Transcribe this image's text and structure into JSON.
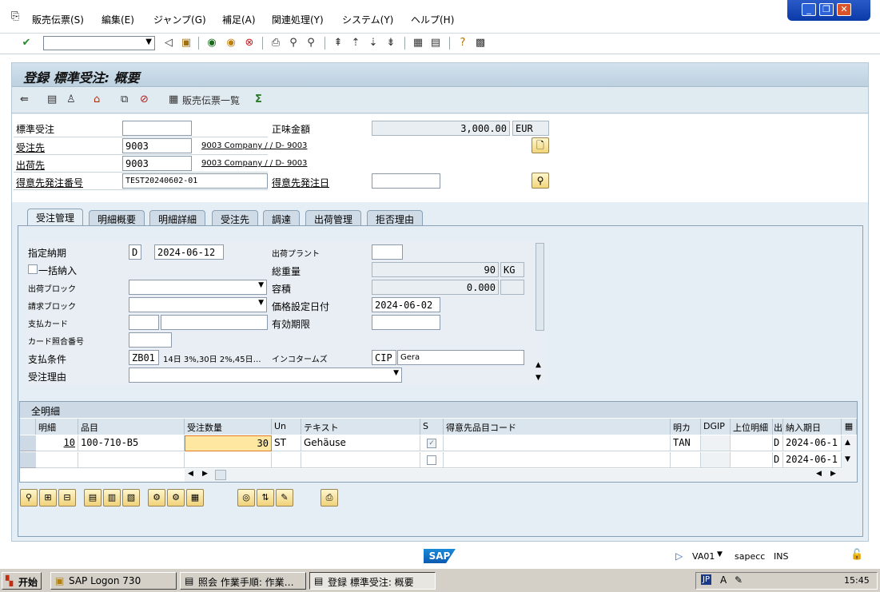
{
  "menu": [
    "販売伝票(S)",
    "編集(E)",
    "ジャンプ(G)",
    "補足(A)",
    "関連処理(Y)",
    "システム(Y)",
    "ヘルプ(H)"
  ],
  "window_title": "登録 標準受注: 概要",
  "app_toolbar": {
    "doc_list_label": "販売伝票一覧"
  },
  "header": {
    "std_order_label": "標準受注",
    "net_value_label": "正味金額",
    "net_value": "3,000.00",
    "currency": "EUR",
    "sold_to_label": "受注先",
    "sold_to": "9003",
    "sold_to_desc": "9003 Company / / D- 9003",
    "ship_to_label": "出荷先",
    "ship_to": "9003",
    "ship_to_desc": "9003 Company / / D- 9003",
    "po_number_label": "得意先発注番号",
    "po_number": "TEST20240602-01",
    "po_date_label": "得意先発注日"
  },
  "tabs": [
    "受注管理",
    "明細概要",
    "明細詳細",
    "受注先",
    "調達",
    "出荷管理",
    "拒否理由"
  ],
  "sales_tab": {
    "req_deliv_label": "指定納期",
    "req_deliv_type": "D",
    "req_deliv_date": "2024-06-12",
    "delivering_plant_label": "出荷プラント",
    "complete_dlv_label": "一括納入",
    "total_weight_label": "総重量",
    "total_weight": "90",
    "weight_unit": "KG",
    "delivery_block_label": "出荷ブロック",
    "volume_label": "容積",
    "volume": "0.000",
    "billing_block_label": "請求ブロック",
    "pricing_date_label": "価格設定日付",
    "pricing_date": "2024-06-02",
    "payment_card_label": "支払カード",
    "valid_to_label": "有効期限",
    "card_verif_label": "カード照合番号",
    "payment_terms_label": "支払条件",
    "payment_terms": "ZB01",
    "payment_terms_desc": "14日 3%,30日 2%,45日…",
    "incoterms_label": "インコタームズ",
    "incoterms": "CIP",
    "incoterms_place": "Gera",
    "order_reason_label": "受注理由"
  },
  "items_table": {
    "title": "全明細",
    "headers": [
      "明細",
      "品目",
      "受注数量",
      "Un",
      "テキスト",
      "S",
      "得意先品目コード",
      "明カ",
      "DGIP",
      "上位明細",
      "出",
      "納入期日"
    ],
    "rows": [
      {
        "item": "10",
        "material": "100-710-B5",
        "qty": "30",
        "unit": "ST",
        "text": "Gehäuse",
        "cat": "TAN",
        "dlv": "D",
        "date": "2024-06-1"
      },
      {
        "item": "",
        "material": "",
        "qty": "",
        "unit": "",
        "text": "",
        "cat": "",
        "dlv": "D",
        "date": "2024-06-1"
      }
    ]
  },
  "status": {
    "sap_logo": "SAP",
    "transaction": "VA01",
    "system": "sapecc",
    "mode": "INS"
  },
  "taskbar": {
    "start": "开始",
    "tasks": [
      "SAP Logon 730",
      "照会 作業手順: 作業…",
      "登録 標準受注: 概要"
    ],
    "lang": "JP",
    "clock": "15:45"
  }
}
